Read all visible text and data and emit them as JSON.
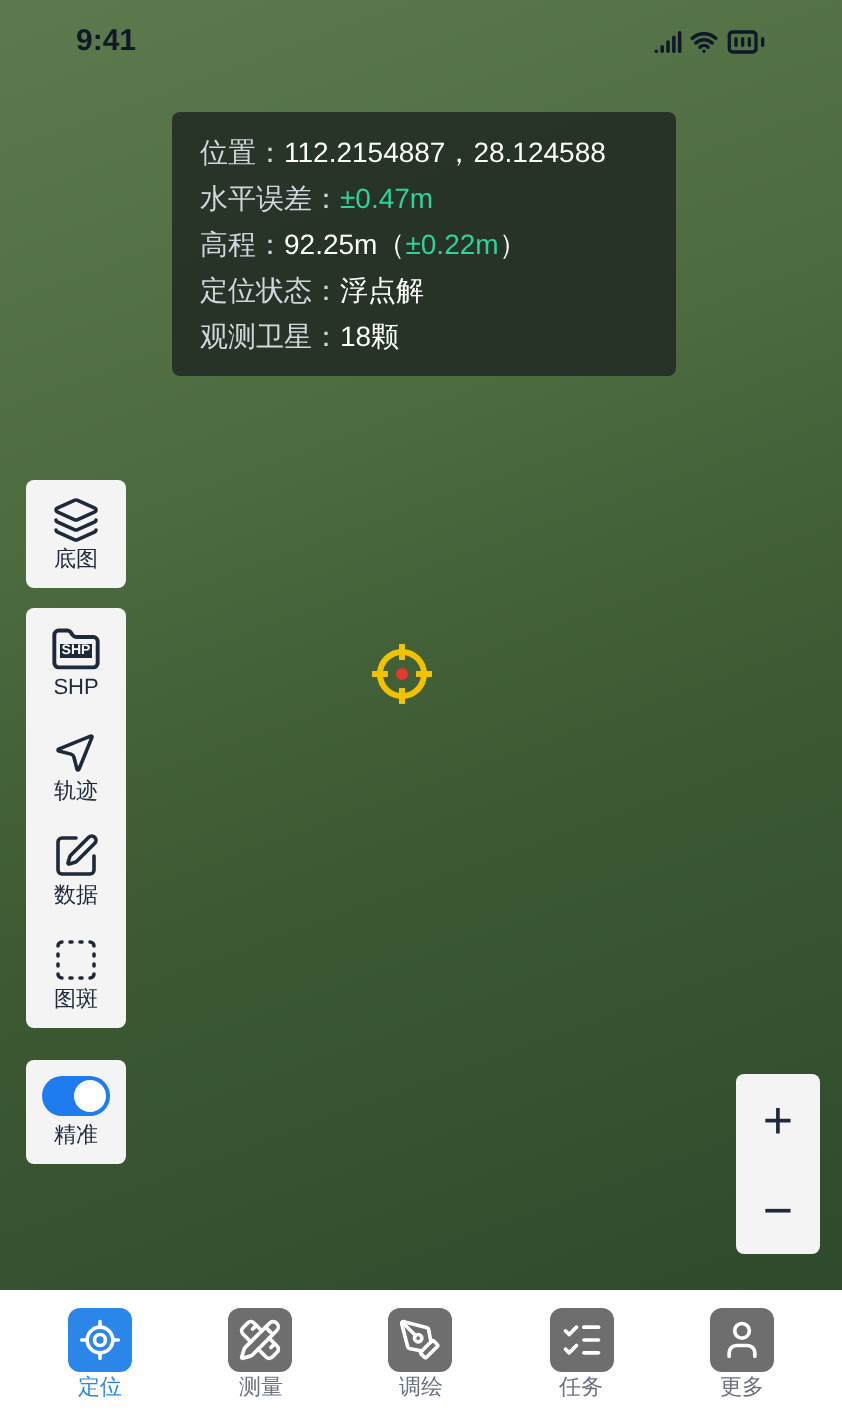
{
  "status_bar": {
    "time": "9:41"
  },
  "info_panel": {
    "rows": [
      {
        "label": "位置：",
        "parts": [
          {
            "text": "112.2154887，28.124588",
            "kind": "normal"
          }
        ]
      },
      {
        "label": "水平误差：",
        "parts": [
          {
            "text": "±0.47m",
            "kind": "accent"
          }
        ]
      },
      {
        "label": "高程：",
        "parts": [
          {
            "text": "92.25m（",
            "kind": "normal"
          },
          {
            "text": "±0.22m",
            "kind": "accent"
          },
          {
            "text": "）",
            "kind": "normal"
          }
        ]
      },
      {
        "label": "定位状态：",
        "parts": [
          {
            "text": "浮点解",
            "kind": "normal"
          }
        ]
      },
      {
        "label": "观测卫星：",
        "parts": [
          {
            "text": "18颗",
            "kind": "normal"
          }
        ]
      }
    ]
  },
  "side_tools": [
    {
      "kind": "card",
      "items": [
        {
          "label": "底图"
        }
      ]
    },
    {
      "kind": "card",
      "items": [
        {
          "icon_text": "SHP",
          "label": "SHP"
        },
        {
          "label": "轨迹"
        },
        {
          "label": "数据"
        },
        {
          "label": "图斑"
        }
      ]
    },
    {
      "kind": "toggle",
      "on": true,
      "label": "精准"
    }
  ],
  "zoom": {
    "in": "+",
    "out": "−"
  },
  "tabs": [
    {
      "label": "定位",
      "selected": true
    },
    {
      "label": "测量",
      "selected": false
    },
    {
      "label": "调绘",
      "selected": false
    },
    {
      "label": "任务",
      "selected": false
    },
    {
      "label": "更多",
      "selected": false
    }
  ]
}
